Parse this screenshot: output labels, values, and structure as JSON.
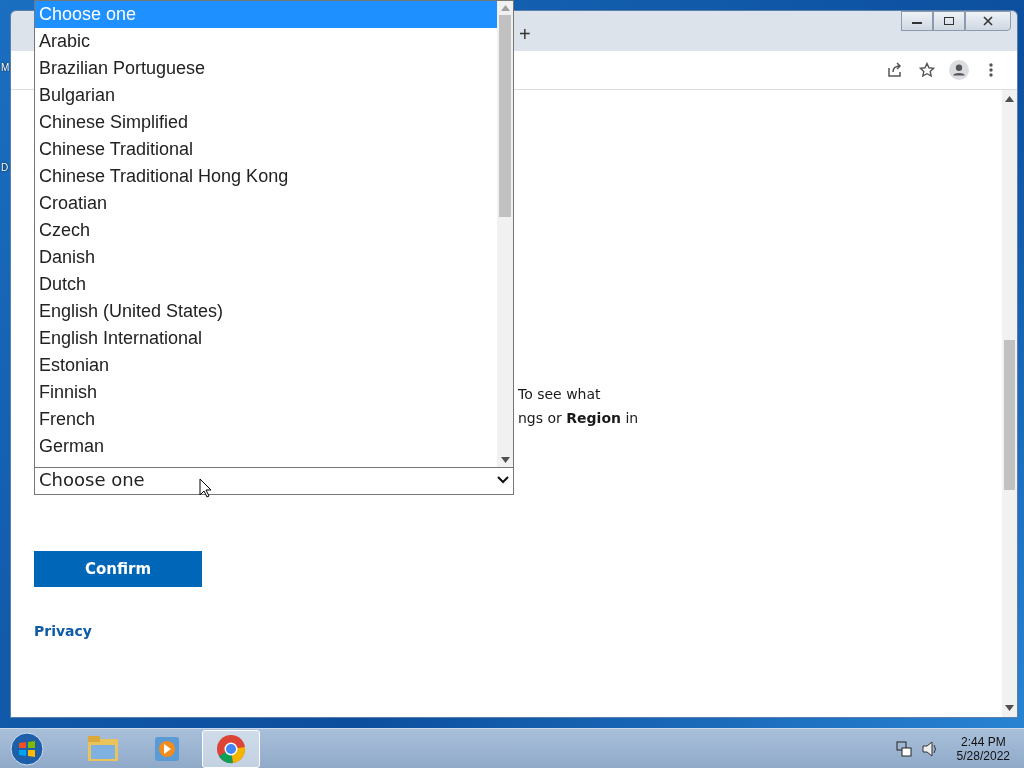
{
  "desktop_icons": [
    {
      "label": "M"
    },
    {
      "label": "D"
    }
  ],
  "browser": {
    "new_tab": "+"
  },
  "page": {
    "paragraph_lines": [
      "To see what",
      "ngs or **Region** in"
    ],
    "select": {
      "value": "Choose one"
    },
    "confirm_button": "Confirm",
    "privacy_link": "Privacy"
  },
  "dropdown_list": {
    "options": [
      {
        "label": "Choose one",
        "selected": true
      },
      {
        "label": "Arabic",
        "selected": false
      },
      {
        "label": "Brazilian Portuguese",
        "selected": false
      },
      {
        "label": "Bulgarian",
        "selected": false
      },
      {
        "label": "Chinese Simplified",
        "selected": false
      },
      {
        "label": "Chinese Traditional",
        "selected": false
      },
      {
        "label": "Chinese Traditional Hong Kong",
        "selected": false
      },
      {
        "label": "Croatian",
        "selected": false
      },
      {
        "label": "Czech",
        "selected": false
      },
      {
        "label": "Danish",
        "selected": false
      },
      {
        "label": "Dutch",
        "selected": false
      },
      {
        "label": "English (United States)",
        "selected": false
      },
      {
        "label": "English International",
        "selected": false
      },
      {
        "label": "Estonian",
        "selected": false
      },
      {
        "label": "Finnish",
        "selected": false
      },
      {
        "label": "French",
        "selected": false
      },
      {
        "label": "German",
        "selected": false
      }
    ]
  },
  "taskbar": {
    "time": "2:44 PM",
    "date": "5/28/2022"
  }
}
